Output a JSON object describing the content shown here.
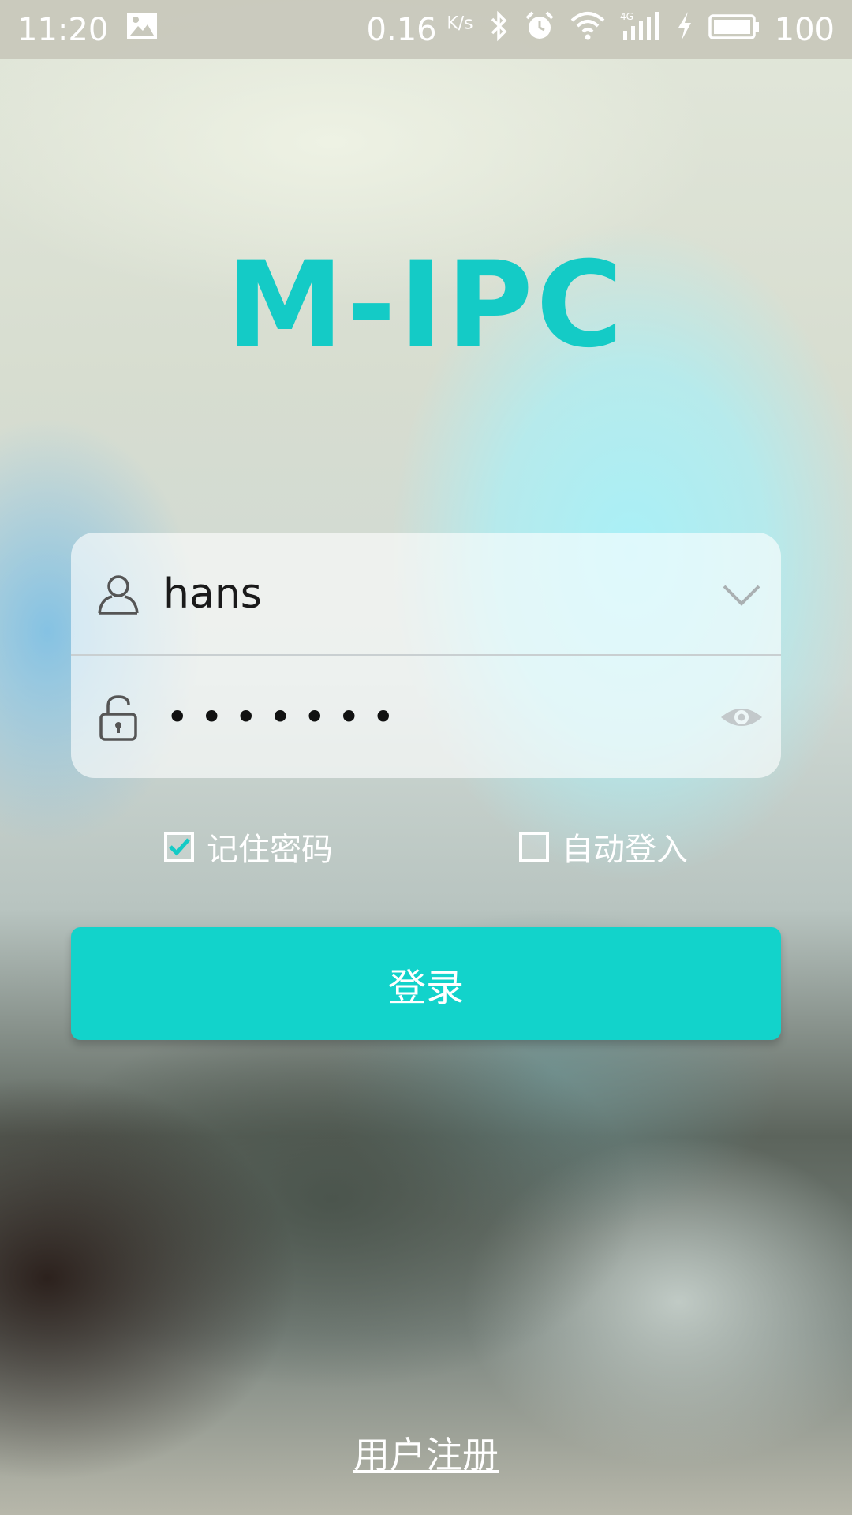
{
  "status_bar": {
    "time": "11:20",
    "net_speed": "0.16",
    "net_unit": "K/s",
    "network_type": "4G",
    "battery": "100",
    "icons": [
      "image-icon",
      "bluetooth-icon",
      "alarm-icon",
      "wifi-icon",
      "signal-icon",
      "charging-icon",
      "battery-icon"
    ]
  },
  "app": {
    "logo_text": "M-IPC",
    "accent_color": "#14cbc6"
  },
  "login_form": {
    "username": {
      "value": "hans",
      "icon": "user-icon",
      "toggle_icon": "chevron-down-icon"
    },
    "password": {
      "masked_value": "•••••••",
      "icon": "lock-icon",
      "toggle_icon": "eye-icon"
    }
  },
  "options": {
    "remember_password": {
      "label": "记住密码",
      "checked": true
    },
    "auto_login": {
      "label": "自动登入",
      "checked": false
    }
  },
  "login_button": {
    "label": "登录",
    "color": "#12d3cb"
  },
  "register_link": {
    "label": "用户注册"
  }
}
